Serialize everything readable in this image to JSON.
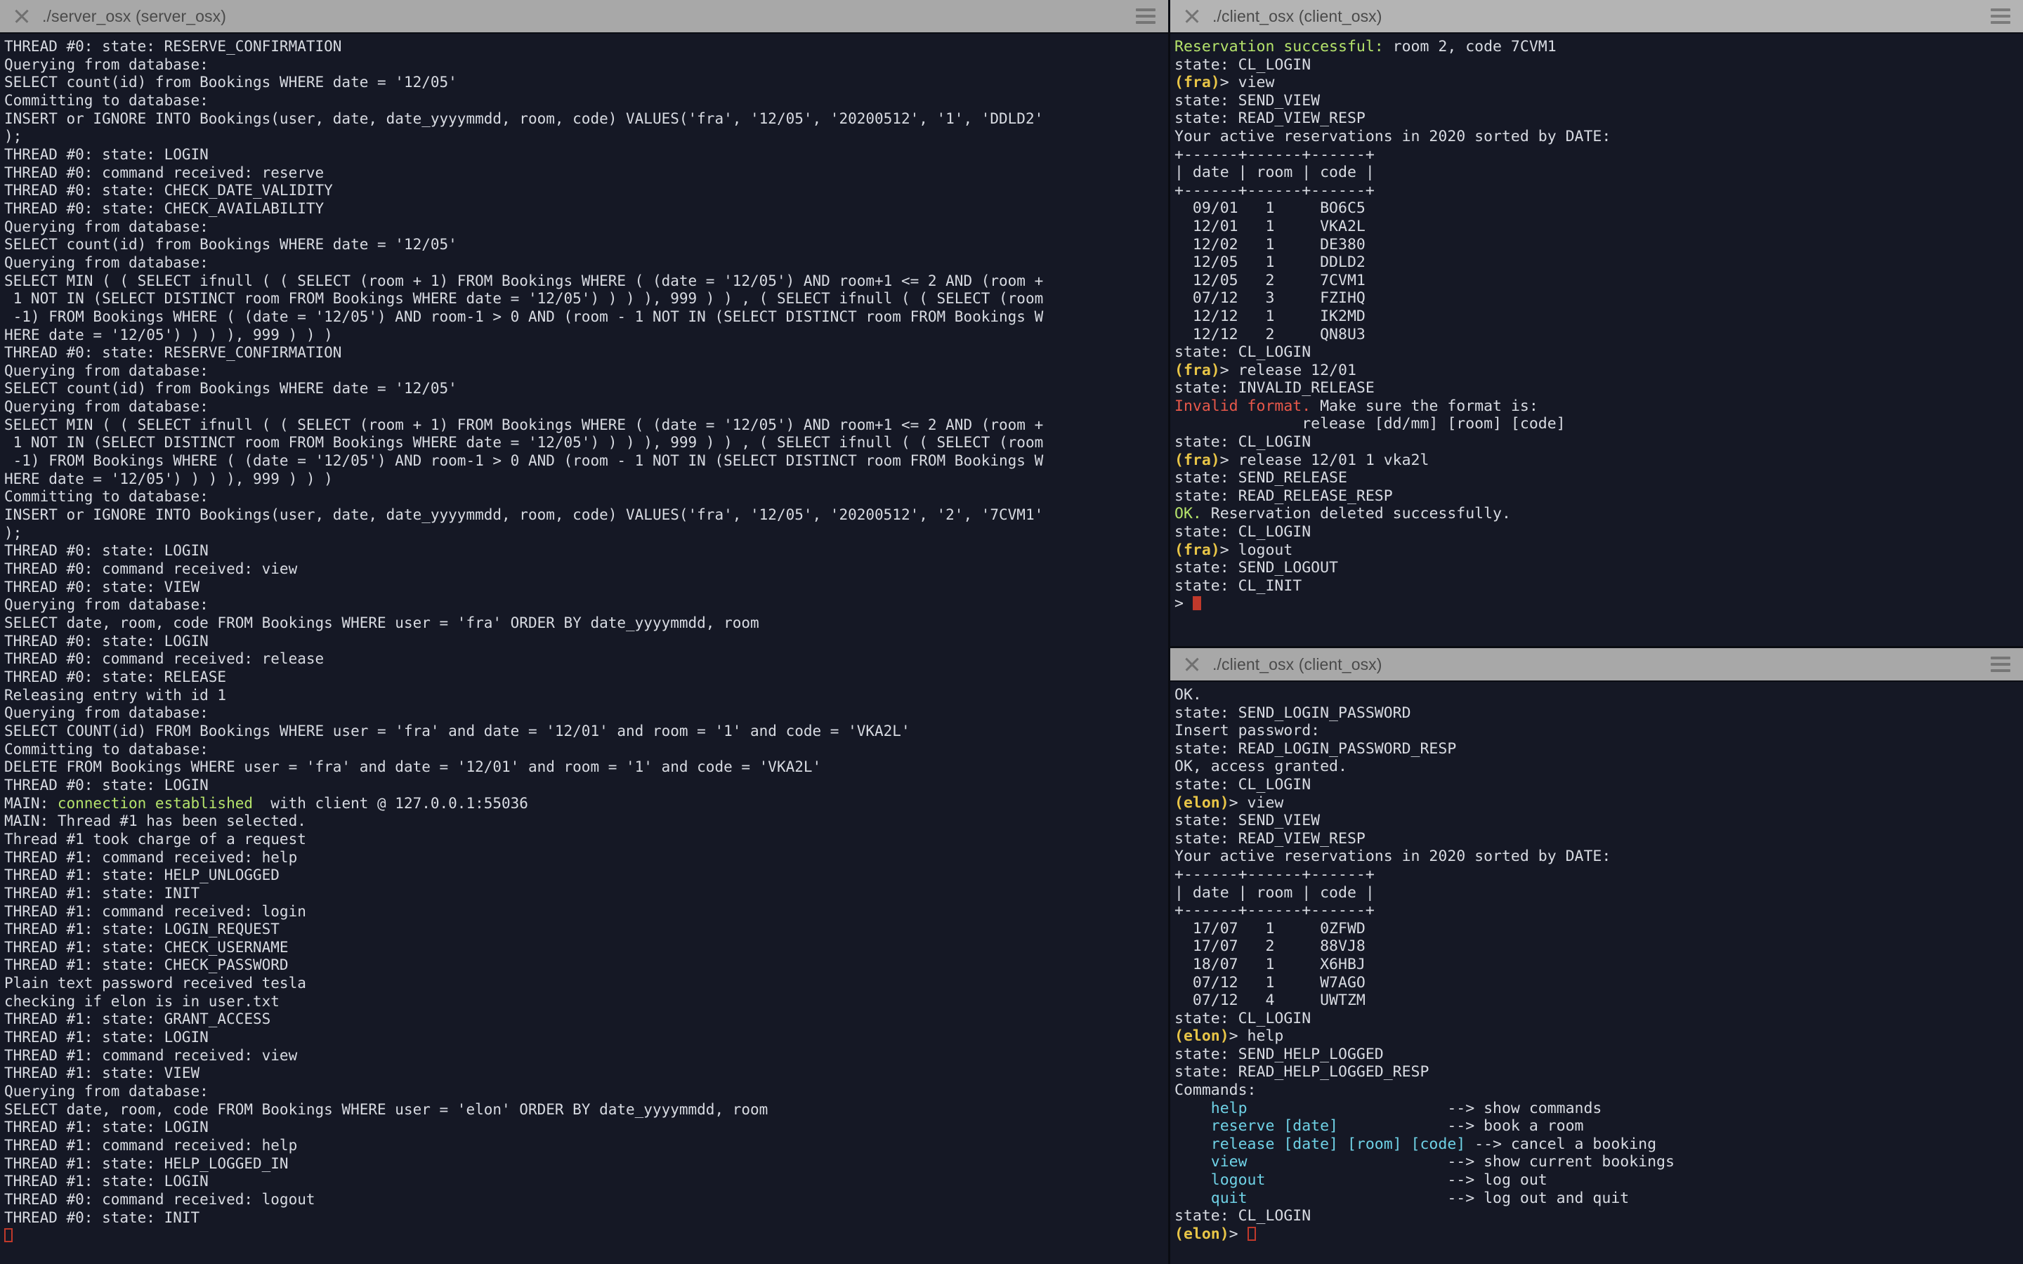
{
  "windows": {
    "server": {
      "title": "./server_osx (server_osx)",
      "close_icon": "close-icon",
      "menu_icon": "hamburger-menu-icon",
      "lines": [
        {
          "t": "THREAD #0: state: RESERVE_CONFIRMATION",
          "c": "dim"
        },
        {
          "t": "Querying from database:",
          "c": ""
        },
        {
          "t": "SELECT count(id) from Bookings WHERE date = '12/05'",
          "c": ""
        },
        {
          "t": "Committing to database:",
          "c": ""
        },
        {
          "t": "INSERT or IGNORE INTO Bookings(user, date, date_yyyymmdd, room, code) VALUES('fra', '12/05', '20200512', '1', 'DDLD2'",
          "c": ""
        },
        {
          "t": ");",
          "c": ""
        },
        {
          "t": "THREAD #0: state: LOGIN",
          "c": "dim"
        },
        {
          "t": "THREAD #0: command received: reserve",
          "c": ""
        },
        {
          "t": "THREAD #0: state: CHECK_DATE_VALIDITY",
          "c": "dim"
        },
        {
          "t": "THREAD #0: state: CHECK_AVAILABILITY",
          "c": "dim"
        },
        {
          "t": "Querying from database:",
          "c": ""
        },
        {
          "t": "SELECT count(id) from Bookings WHERE date = '12/05'",
          "c": ""
        },
        {
          "t": "Querying from database:",
          "c": ""
        },
        {
          "t": "SELECT MIN ( ( SELECT ifnull ( ( SELECT (room + 1) FROM Bookings WHERE ( (date = '12/05') AND room+1 <= 2 AND (room +",
          "c": ""
        },
        {
          "t": " 1 NOT IN (SELECT DISTINCT room FROM Bookings WHERE date = '12/05') ) ) ), 999 ) ) , ( SELECT ifnull ( ( SELECT (room",
          "c": ""
        },
        {
          "t": " -1) FROM Bookings WHERE ( (date = '12/05') AND room-1 > 0 AND (room - 1 NOT IN (SELECT DISTINCT room FROM Bookings W",
          "c": ""
        },
        {
          "t": "HERE date = '12/05') ) ) ), 999 ) ) )",
          "c": ""
        },
        {
          "t": "THREAD #0: state: RESERVE_CONFIRMATION",
          "c": "dim"
        },
        {
          "t": "Querying from database:",
          "c": ""
        },
        {
          "t": "SELECT count(id) from Bookings WHERE date = '12/05'",
          "c": ""
        },
        {
          "t": "Querying from database:",
          "c": ""
        },
        {
          "t": "SELECT MIN ( ( SELECT ifnull ( ( SELECT (room + 1) FROM Bookings WHERE ( (date = '12/05') AND room+1 <= 2 AND (room +",
          "c": ""
        },
        {
          "t": " 1 NOT IN (SELECT DISTINCT room FROM Bookings WHERE date = '12/05') ) ) ), 999 ) ) , ( SELECT ifnull ( ( SELECT (room",
          "c": ""
        },
        {
          "t": " -1) FROM Bookings WHERE ( (date = '12/05') AND room-1 > 0 AND (room - 1 NOT IN (SELECT DISTINCT room FROM Bookings W",
          "c": ""
        },
        {
          "t": "HERE date = '12/05') ) ) ), 999 ) ) )",
          "c": ""
        },
        {
          "t": "Committing to database:",
          "c": ""
        },
        {
          "t": "INSERT or IGNORE INTO Bookings(user, date, date_yyyymmdd, room, code) VALUES('fra', '12/05', '20200512', '2', '7CVM1'",
          "c": ""
        },
        {
          "t": ");",
          "c": ""
        },
        {
          "t": "THREAD #0: state: LOGIN",
          "c": "dim"
        },
        {
          "t": "THREAD #0: command received: view",
          "c": ""
        },
        {
          "t": "THREAD #0: state: VIEW",
          "c": "dim"
        },
        {
          "t": "Querying from database:",
          "c": ""
        },
        {
          "t": "SELECT date, room, code FROM Bookings WHERE user = 'fra' ORDER BY date_yyyymmdd, room",
          "c": ""
        },
        {
          "t": "THREAD #0: state: LOGIN",
          "c": "dim"
        },
        {
          "t": "THREAD #0: command received: release",
          "c": ""
        },
        {
          "t": "THREAD #0: state: RELEASE",
          "c": "dim"
        },
        {
          "t": "Releasing entry with id 1",
          "c": ""
        },
        {
          "t": "Querying from database:",
          "c": ""
        },
        {
          "t": "SELECT COUNT(id) FROM Bookings WHERE user = 'fra' and date = '12/01' and room = '1' and code = 'VKA2L'",
          "c": ""
        },
        {
          "t": "Committing to database:",
          "c": ""
        },
        {
          "t": "DELETE FROM Bookings WHERE user = 'fra' and date = '12/01' and room = '1' and code = 'VKA2L'",
          "c": ""
        },
        {
          "t": "THREAD #0: state: LOGIN",
          "c": "dim"
        },
        {
          "t": "MAIN: @@connection established@@  with client @ 127.0.0.1:55036",
          "c": "green-seg"
        },
        {
          "t": "MAIN: Thread #1 has been selected.",
          "c": ""
        },
        {
          "t": "Thread #1 took charge of a request",
          "c": ""
        },
        {
          "t": "THREAD #1: command received: help",
          "c": ""
        },
        {
          "t": "THREAD #1: state: HELP_UNLOGGED",
          "c": "dim"
        },
        {
          "t": "THREAD #1: state: INIT",
          "c": "dim"
        },
        {
          "t": "THREAD #1: command received: login",
          "c": ""
        },
        {
          "t": "THREAD #1: state: LOGIN_REQUEST",
          "c": "dim"
        },
        {
          "t": "THREAD #1: state: CHECK_USERNAME",
          "c": "dim"
        },
        {
          "t": "THREAD #1: state: CHECK_PASSWORD",
          "c": "dim"
        },
        {
          "t": "Plain text password received tesla",
          "c": ""
        },
        {
          "t": "checking if elon is in user.txt",
          "c": ""
        },
        {
          "t": "THREAD #1: state: GRANT_ACCESS",
          "c": "dim"
        },
        {
          "t": "THREAD #1: state: LOGIN",
          "c": "dim"
        },
        {
          "t": "THREAD #1: command received: view",
          "c": ""
        },
        {
          "t": "THREAD #1: state: VIEW",
          "c": "dim"
        },
        {
          "t": "Querying from database:",
          "c": ""
        },
        {
          "t": "SELECT date, room, code FROM Bookings WHERE user = 'elon' ORDER BY date_yyyymmdd, room",
          "c": ""
        },
        {
          "t": "THREAD #1: state: LOGIN",
          "c": "dim"
        },
        {
          "t": "THREAD #1: command received: help",
          "c": ""
        },
        {
          "t": "THREAD #1: state: HELP_LOGGED_IN",
          "c": "dim"
        },
        {
          "t": "THREAD #1: state: LOGIN",
          "c": "dim"
        },
        {
          "t": "THREAD #0: command received: logout",
          "c": ""
        },
        {
          "t": "THREAD #0: state: INIT",
          "c": "dim"
        },
        {
          "t": "@@CURSOR_HOLLOW@@",
          "c": "cursor-hollow"
        }
      ]
    },
    "client_top": {
      "title": "./client_osx (client_osx)",
      "close_icon": "close-icon",
      "menu_icon": "hamburger-menu-icon",
      "lines": [
        {
          "t": "Reservation successful: room 2, code 7CVM1",
          "c": "green-prefix",
          "prefix": "Reservation successful:",
          "rest": " room 2, code 7CVM1"
        },
        {
          "t": "state: CL_LOGIN",
          "c": "dim"
        },
        {
          "t": "(fra)> view",
          "c": "prompt",
          "user": "(fra)",
          "rest": "> view"
        },
        {
          "t": "state: SEND_VIEW",
          "c": "dim"
        },
        {
          "t": "state: READ_VIEW_RESP",
          "c": "dim"
        },
        {
          "t": "Your active reservations in 2020 sorted by DATE:",
          "c": ""
        },
        {
          "t": "+------+------+------+",
          "c": ""
        },
        {
          "t": "| date | room | code |",
          "c": ""
        },
        {
          "t": "+------+------+------+",
          "c": ""
        },
        {
          "t": "  09/01   1     BO6C5",
          "c": ""
        },
        {
          "t": "  12/01   1     VKA2L",
          "c": ""
        },
        {
          "t": "  12/02   1     DE380",
          "c": ""
        },
        {
          "t": "  12/05   1     DDLD2",
          "c": ""
        },
        {
          "t": "  12/05   2     7CVM1",
          "c": ""
        },
        {
          "t": "  07/12   3     FZIHQ",
          "c": ""
        },
        {
          "t": "  12/12   1     IK2MD",
          "c": ""
        },
        {
          "t": "  12/12   2     QN8U3",
          "c": ""
        },
        {
          "t": "state: CL_LOGIN",
          "c": "dim"
        },
        {
          "t": "(fra)> release 12/01",
          "c": "prompt",
          "user": "(fra)",
          "rest": "> release 12/01"
        },
        {
          "t": "state: INVALID_RELEASE",
          "c": "dim"
        },
        {
          "t": "Invalid format. Make sure the format is:",
          "c": "red-prefix",
          "prefix": "Invalid format.",
          "rest": " Make sure the format is:"
        },
        {
          "t": "              release [dd/mm] [room] [code]",
          "c": ""
        },
        {
          "t": "state: CL_LOGIN",
          "c": "dim"
        },
        {
          "t": "(fra)> release 12/01 1 vka2l",
          "c": "prompt",
          "user": "(fra)",
          "rest": "> release 12/01 1 vka2l"
        },
        {
          "t": "state: SEND_RELEASE",
          "c": "dim"
        },
        {
          "t": "state: READ_RELEASE_RESP",
          "c": "dim"
        },
        {
          "t": "OK. Reservation deleted successfully.",
          "c": "green-prefix",
          "prefix": "OK.",
          "rest": " Reservation deleted successfully."
        },
        {
          "t": "state: CL_LOGIN",
          "c": "dim"
        },
        {
          "t": "(fra)> logout",
          "c": "prompt",
          "user": "(fra)",
          "rest": "> logout"
        },
        {
          "t": "state: SEND_LOGOUT",
          "c": "dim"
        },
        {
          "t": "state: CL_INIT",
          "c": "dim"
        },
        {
          "t": "> @@CURSOR@@",
          "c": "cursor-solid",
          "rest": "> "
        }
      ]
    },
    "client_bottom": {
      "title": "./client_osx (client_osx)",
      "close_icon": "close-icon",
      "menu_icon": "hamburger-menu-icon",
      "lines": [
        {
          "t": "OK.",
          "c": ""
        },
        {
          "t": "state: SEND_LOGIN_PASSWORD",
          "c": "dim"
        },
        {
          "t": "Insert password:",
          "c": ""
        },
        {
          "t": "state: READ_LOGIN_PASSWORD_RESP",
          "c": "dim"
        },
        {
          "t": "OK, access granted.",
          "c": ""
        },
        {
          "t": "state: CL_LOGIN",
          "c": "dim"
        },
        {
          "t": "(elon)> view",
          "c": "prompt",
          "user": "(elon)",
          "rest": "> view"
        },
        {
          "t": "state: SEND_VIEW",
          "c": "dim"
        },
        {
          "t": "state: READ_VIEW_RESP",
          "c": "dim"
        },
        {
          "t": "Your active reservations in 2020 sorted by DATE:",
          "c": ""
        },
        {
          "t": "+------+------+------+",
          "c": ""
        },
        {
          "t": "| date | room | code |",
          "c": ""
        },
        {
          "t": "+------+------+------+",
          "c": ""
        },
        {
          "t": "  17/07   1     0ZFWD",
          "c": ""
        },
        {
          "t": "  17/07   2     88VJ8",
          "c": ""
        },
        {
          "t": "  18/07   1     X6HBJ",
          "c": ""
        },
        {
          "t": "  07/12   1     W7AGO",
          "c": ""
        },
        {
          "t": "  07/12   4     UWTZM",
          "c": ""
        },
        {
          "t": "state: CL_LOGIN",
          "c": "dim"
        },
        {
          "t": "(elon)> help",
          "c": "prompt",
          "user": "(elon)",
          "rest": "> help"
        },
        {
          "t": "state: SEND_HELP_LOGGED",
          "c": "dim"
        },
        {
          "t": "state: READ_HELP_LOGGED_RESP",
          "c": "dim"
        },
        {
          "t": "Commands:",
          "c": ""
        },
        {
          "t": "    help                      --> show commands",
          "c": "cmd",
          "cmd": "    help                      ",
          "desc": "--> show commands"
        },
        {
          "t": "    reserve [date]            --> book a room",
          "c": "cmd",
          "cmd": "    reserve [date]            ",
          "desc": "--> book a room"
        },
        {
          "t": "    release [date] [room] [code] --> cancel a booking",
          "c": "cmd",
          "cmd": "    release [date] [room] [code] ",
          "desc": "--> cancel a booking"
        },
        {
          "t": "    view                      --> show current bookings",
          "c": "cmd",
          "cmd": "    view                      ",
          "desc": "--> show current bookings"
        },
        {
          "t": "    logout                    --> log out",
          "c": "cmd",
          "cmd": "    logout                    ",
          "desc": "--> log out"
        },
        {
          "t": "    quit                      --> log out and quit",
          "c": "cmd",
          "cmd": "    quit                      ",
          "desc": "--> log out and quit"
        },
        {
          "t": "",
          "c": ""
        },
        {
          "t": "state: CL_LOGIN",
          "c": "dim"
        },
        {
          "t": "(elon)> @@CURSOR_HOLLOW@@",
          "c": "prompt-cursor",
          "user": "(elon)",
          "rest": "> "
        }
      ]
    }
  },
  "colors": {
    "terminal_bg": "#151825",
    "titlebar_bg": "#a8a8a8",
    "titlebar_bg_active": "#b4b4b4",
    "text": "#d8dbe2",
    "dim": "#5b6070",
    "green": "#b5e36b",
    "red": "#e8584a",
    "yellow": "#e8c547",
    "cyan": "#6fd2e6",
    "cursor": "#c0392b"
  }
}
